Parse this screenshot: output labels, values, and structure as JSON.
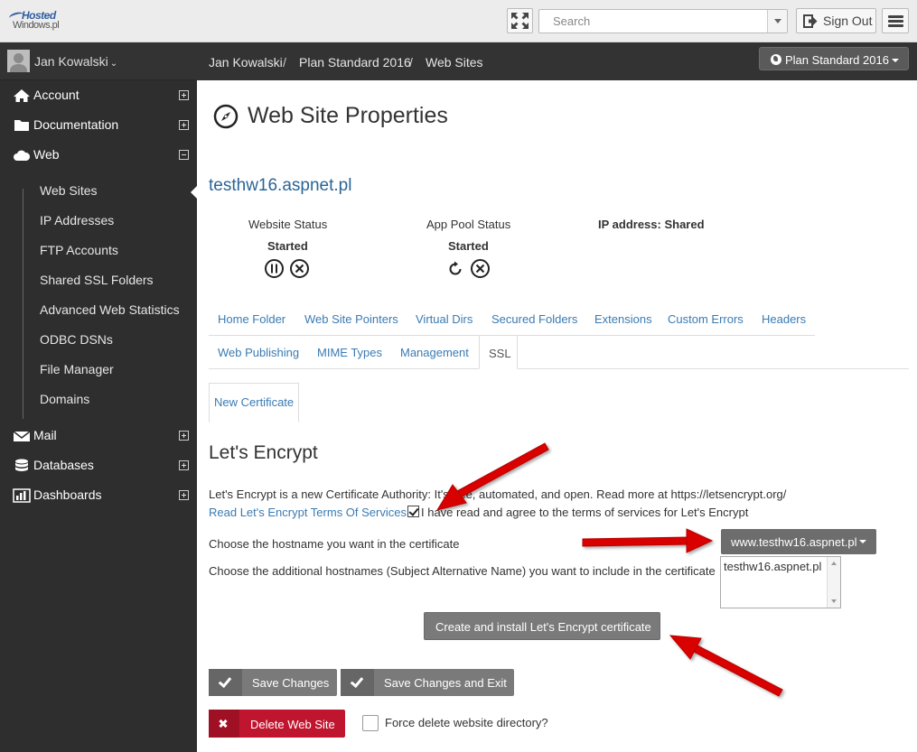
{
  "header": {
    "logo_line1": "Hosted",
    "logo_line2": "Windows.pl",
    "search_placeholder": "Search",
    "signout_label": "Sign Out"
  },
  "sidebar": {
    "user_name": "Jan Kowalski",
    "items": [
      {
        "label": "Account",
        "icon": "home-icon",
        "expander": "plus"
      },
      {
        "label": "Documentation",
        "icon": "folder-icon",
        "expander": "plus"
      },
      {
        "label": "Web",
        "icon": "cloud-icon",
        "expander": "minus"
      },
      {
        "label": "Mail",
        "icon": "envelope-icon",
        "expander": "plus"
      },
      {
        "label": "Databases",
        "icon": "database-icon",
        "expander": "plus"
      },
      {
        "label": "Dashboards",
        "icon": "bar-chart-icon",
        "expander": "plus"
      }
    ],
    "web_subitems": [
      "Web Sites",
      "IP Addresses",
      "FTP Accounts",
      "Shared SSL Folders",
      "Advanced Web Statistics",
      "ODBC DSNs",
      "File Manager",
      "Domains"
    ],
    "active_subitem": "Web Sites"
  },
  "breadcrumb": {
    "items": [
      "Jan Kowalski",
      "Plan Standard 2016",
      "Web Sites"
    ],
    "separator": "/",
    "plan_button": "Plan Standard 2016"
  },
  "page": {
    "title": "Web Site Properties",
    "site_name": "testhw16.aspnet.pl",
    "website_status_label": "Website Status",
    "website_status_value": "Started",
    "app_pool_status_label": "App Pool Status",
    "app_pool_status_value": "Started",
    "ip_address_label": "IP address: Shared"
  },
  "tabs": {
    "row1": [
      "Home Folder",
      "Web Site Pointers",
      "Virtual Dirs",
      "Secured Folders",
      "Extensions",
      "Custom Errors",
      "Headers"
    ],
    "row2": [
      "Web Publishing",
      "MIME Types",
      "Management",
      "SSL"
    ],
    "active": "SSL",
    "subtab": "New Certificate"
  },
  "ssl": {
    "heading": "Let's Encrypt",
    "intro": "Let's Encrypt is a new Certificate Authority: It's free, automated, and open. Read more at https://letsencrypt.org/",
    "tos_link": "Read Let's Encrypt Terms Of Services",
    "agree_text": "I have read and agree to the terms of services for Let's Encrypt",
    "agree_checked": true,
    "hostname_label": "Choose the hostname you want in the certificate",
    "hostname_selected": "www.testhw16.aspnet.pl",
    "alt_names_label": "Choose the additional hostnames (Subject Alternative Name) you want to include in the certificate",
    "alt_names_options": [
      "testhw16.aspnet.pl"
    ],
    "create_button": "Create and install Let's Encrypt certificate"
  },
  "footer": {
    "save_label": "Save Changes",
    "save_exit_label": "Save Changes and Exit",
    "delete_label": "Delete Web Site",
    "force_delete_label": "Force delete website directory?",
    "force_delete_checked": false
  },
  "colors": {
    "sidebar_bg": "#2e2e2e",
    "link": "#3a7bb3",
    "danger": "#c0152f",
    "button_gray": "#7a7a7a",
    "annotation_arrow": "#d90000"
  }
}
